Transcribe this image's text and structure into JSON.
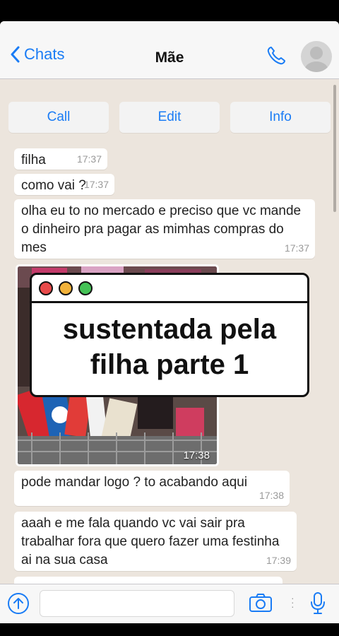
{
  "header": {
    "back_label": "Chats",
    "title": "Mãe"
  },
  "actions": [
    {
      "label": "Call"
    },
    {
      "label": "Edit"
    },
    {
      "label": "Info"
    }
  ],
  "messages": [
    {
      "text": "filha",
      "time": "17:37"
    },
    {
      "text": "como vai ?",
      "time": "17:37"
    },
    {
      "text": "olha eu to no mercado e preciso que vc mande o dinheiro pra pagar as mimhas compras do mes",
      "time": "17:37"
    },
    {
      "type": "photo",
      "time": "17:38"
    },
    {
      "text": "pode mandar logo ? to acabando aqui",
      "time": "17:38"
    },
    {
      "text": "aaah e me fala quando vc vai sair pra trabalhar fora que quero fazer uma festinha ai na sua casa",
      "time": "17:39"
    }
  ],
  "overlay": {
    "line1": "sustentada pela",
    "line2": "filha parte 1",
    "dot_colors": [
      "#e84a4a",
      "#f2b23a",
      "#44c256"
    ]
  },
  "colors": {
    "accent": "#1a7cf5",
    "chat_background": "#ece5dd"
  }
}
